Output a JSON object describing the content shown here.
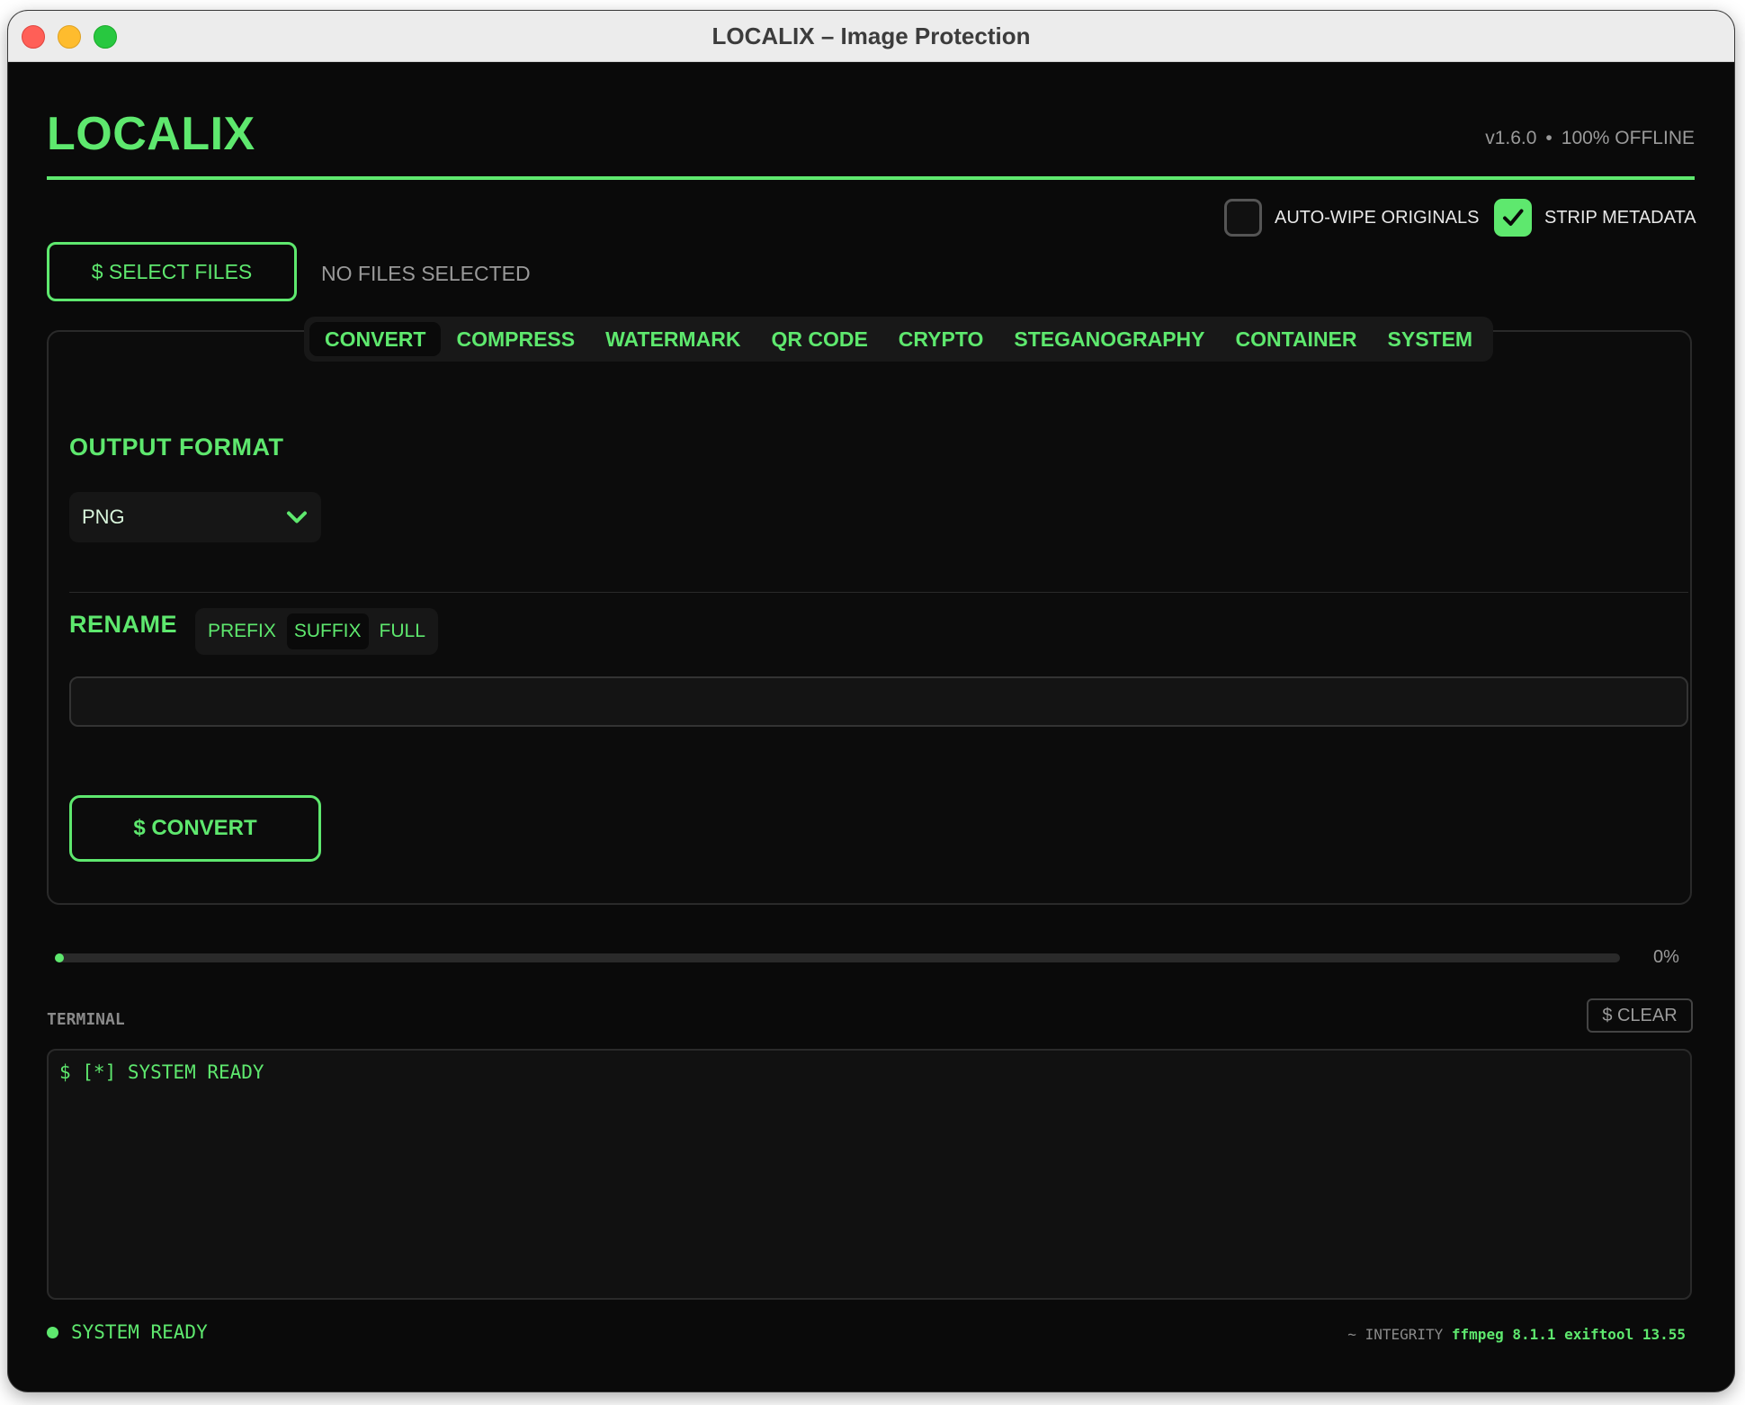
{
  "window": {
    "title": "LOCALIX – Image Protection"
  },
  "header": {
    "logo": "LOCALIX",
    "version": "v1.6.0",
    "offline": "100% OFFLINE",
    "separator": "•"
  },
  "options": {
    "auto_wipe": {
      "label": "AUTO-WIPE ORIGINALS",
      "checked": false
    },
    "strip_metadata": {
      "label": "STRIP METADATA",
      "checked": true
    }
  },
  "files": {
    "select_label": "$ SELECT FILES",
    "status": "NO FILES SELECTED"
  },
  "tabs": [
    {
      "label": "CONVERT",
      "active": true
    },
    {
      "label": "COMPRESS",
      "active": false
    },
    {
      "label": "WATERMARK",
      "active": false
    },
    {
      "label": "QR CODE",
      "active": false
    },
    {
      "label": "CRYPTO",
      "active": false
    },
    {
      "label": "STEGANOGRAPHY",
      "active": false
    },
    {
      "label": "CONTAINER",
      "active": false
    },
    {
      "label": "SYSTEM",
      "active": false
    }
  ],
  "convert": {
    "output_format_label": "OUTPUT FORMAT",
    "output_format_value": "PNG",
    "rename_label": "RENAME",
    "rename_modes": [
      {
        "label": "PREFIX",
        "active": false
      },
      {
        "label": "SUFFIX",
        "active": true
      },
      {
        "label": "FULL",
        "active": false
      }
    ],
    "rename_value": "",
    "action_label": "$ CONVERT"
  },
  "progress": {
    "value": 0,
    "label": "0%"
  },
  "terminal": {
    "label": "TERMINAL",
    "clear_label": "$ CLEAR",
    "lines": [
      "$ [*] SYSTEM READY"
    ]
  },
  "status_bar": {
    "status": "SYSTEM READY",
    "integrity_label": "~ INTEGRITY",
    "integrity_value": "ffmpeg 8.1.1 exiftool 13.55"
  },
  "colors": {
    "accent": "#5ee86e",
    "background": "#0a0a0a",
    "muted": "#9a9a9a"
  },
  "icons": {
    "format_dropdown": "chevron-down-icon",
    "checkbox_checked": "checkmark-icon"
  }
}
